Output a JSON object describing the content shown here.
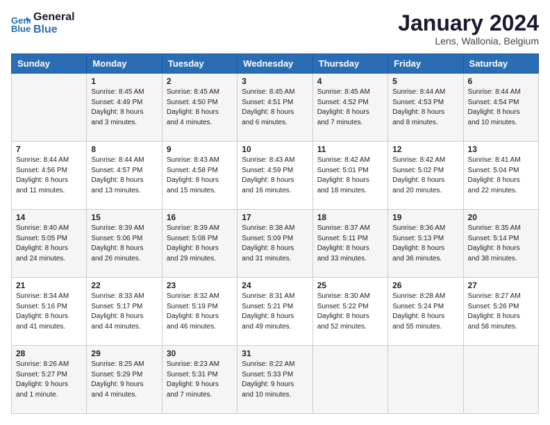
{
  "logo": {
    "line1": "General",
    "line2": "Blue"
  },
  "header": {
    "month": "January 2024",
    "location": "Lens, Wallonia, Belgium"
  },
  "weekdays": [
    "Sunday",
    "Monday",
    "Tuesday",
    "Wednesday",
    "Thursday",
    "Friday",
    "Saturday"
  ],
  "weeks": [
    [
      {
        "day": "",
        "info": ""
      },
      {
        "day": "1",
        "info": "Sunrise: 8:45 AM\nSunset: 4:49 PM\nDaylight: 8 hours\nand 3 minutes."
      },
      {
        "day": "2",
        "info": "Sunrise: 8:45 AM\nSunset: 4:50 PM\nDaylight: 8 hours\nand 4 minutes."
      },
      {
        "day": "3",
        "info": "Sunrise: 8:45 AM\nSunset: 4:51 PM\nDaylight: 8 hours\nand 6 minutes."
      },
      {
        "day": "4",
        "info": "Sunrise: 8:45 AM\nSunset: 4:52 PM\nDaylight: 8 hours\nand 7 minutes."
      },
      {
        "day": "5",
        "info": "Sunrise: 8:44 AM\nSunset: 4:53 PM\nDaylight: 8 hours\nand 8 minutes."
      },
      {
        "day": "6",
        "info": "Sunrise: 8:44 AM\nSunset: 4:54 PM\nDaylight: 8 hours\nand 10 minutes."
      }
    ],
    [
      {
        "day": "7",
        "info": "Sunrise: 8:44 AM\nSunset: 4:56 PM\nDaylight: 8 hours\nand 11 minutes."
      },
      {
        "day": "8",
        "info": "Sunrise: 8:44 AM\nSunset: 4:57 PM\nDaylight: 8 hours\nand 13 minutes."
      },
      {
        "day": "9",
        "info": "Sunrise: 8:43 AM\nSunset: 4:58 PM\nDaylight: 8 hours\nand 15 minutes."
      },
      {
        "day": "10",
        "info": "Sunrise: 8:43 AM\nSunset: 4:59 PM\nDaylight: 8 hours\nand 16 minutes."
      },
      {
        "day": "11",
        "info": "Sunrise: 8:42 AM\nSunset: 5:01 PM\nDaylight: 8 hours\nand 18 minutes."
      },
      {
        "day": "12",
        "info": "Sunrise: 8:42 AM\nSunset: 5:02 PM\nDaylight: 8 hours\nand 20 minutes."
      },
      {
        "day": "13",
        "info": "Sunrise: 8:41 AM\nSunset: 5:04 PM\nDaylight: 8 hours\nand 22 minutes."
      }
    ],
    [
      {
        "day": "14",
        "info": "Sunrise: 8:40 AM\nSunset: 5:05 PM\nDaylight: 8 hours\nand 24 minutes."
      },
      {
        "day": "15",
        "info": "Sunrise: 8:39 AM\nSunset: 5:06 PM\nDaylight: 8 hours\nand 26 minutes."
      },
      {
        "day": "16",
        "info": "Sunrise: 8:39 AM\nSunset: 5:08 PM\nDaylight: 8 hours\nand 29 minutes."
      },
      {
        "day": "17",
        "info": "Sunrise: 8:38 AM\nSunset: 5:09 PM\nDaylight: 8 hours\nand 31 minutes."
      },
      {
        "day": "18",
        "info": "Sunrise: 8:37 AM\nSunset: 5:11 PM\nDaylight: 8 hours\nand 33 minutes."
      },
      {
        "day": "19",
        "info": "Sunrise: 8:36 AM\nSunset: 5:13 PM\nDaylight: 8 hours\nand 36 minutes."
      },
      {
        "day": "20",
        "info": "Sunrise: 8:35 AM\nSunset: 5:14 PM\nDaylight: 8 hours\nand 38 minutes."
      }
    ],
    [
      {
        "day": "21",
        "info": "Sunrise: 8:34 AM\nSunset: 5:16 PM\nDaylight: 8 hours\nand 41 minutes."
      },
      {
        "day": "22",
        "info": "Sunrise: 8:33 AM\nSunset: 5:17 PM\nDaylight: 8 hours\nand 44 minutes."
      },
      {
        "day": "23",
        "info": "Sunrise: 8:32 AM\nSunset: 5:19 PM\nDaylight: 8 hours\nand 46 minutes."
      },
      {
        "day": "24",
        "info": "Sunrise: 8:31 AM\nSunset: 5:21 PM\nDaylight: 8 hours\nand 49 minutes."
      },
      {
        "day": "25",
        "info": "Sunrise: 8:30 AM\nSunset: 5:22 PM\nDaylight: 8 hours\nand 52 minutes."
      },
      {
        "day": "26",
        "info": "Sunrise: 8:28 AM\nSunset: 5:24 PM\nDaylight: 8 hours\nand 55 minutes."
      },
      {
        "day": "27",
        "info": "Sunrise: 8:27 AM\nSunset: 5:26 PM\nDaylight: 8 hours\nand 58 minutes."
      }
    ],
    [
      {
        "day": "28",
        "info": "Sunrise: 8:26 AM\nSunset: 5:27 PM\nDaylight: 9 hours\nand 1 minute."
      },
      {
        "day": "29",
        "info": "Sunrise: 8:25 AM\nSunset: 5:29 PM\nDaylight: 9 hours\nand 4 minutes."
      },
      {
        "day": "30",
        "info": "Sunrise: 8:23 AM\nSunset: 5:31 PM\nDaylight: 9 hours\nand 7 minutes."
      },
      {
        "day": "31",
        "info": "Sunrise: 8:22 AM\nSunset: 5:33 PM\nDaylight: 9 hours\nand 10 minutes."
      },
      {
        "day": "",
        "info": ""
      },
      {
        "day": "",
        "info": ""
      },
      {
        "day": "",
        "info": ""
      }
    ]
  ]
}
